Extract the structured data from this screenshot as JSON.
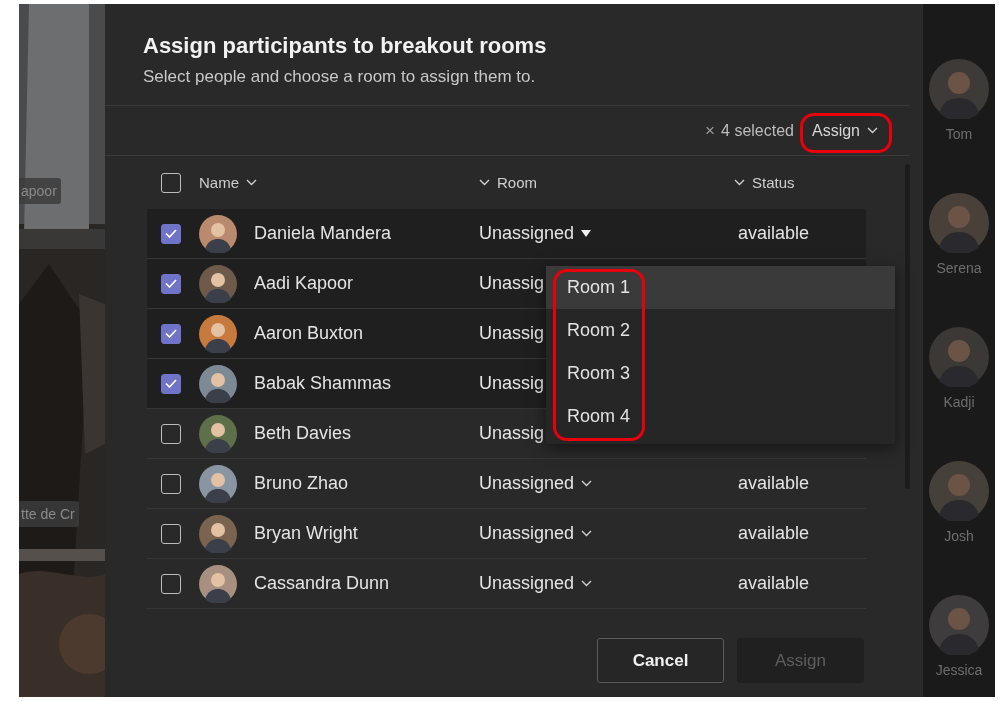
{
  "background_video": {
    "name_tags": [
      "apoor",
      "tte de Cr"
    ]
  },
  "dialog": {
    "title": "Assign participants to breakout rooms",
    "subtitle": "Select people and choose a room to assign them to.",
    "toolbar": {
      "clear": "×",
      "selected_count": "4 selected",
      "assign": "Assign"
    },
    "table": {
      "columns": [
        "Name",
        "Room",
        "Status"
      ],
      "select_all_checked": false,
      "rows": [
        {
          "name": "Daniela Mandera",
          "room": "Unassigned",
          "room_menu_open": true,
          "status": "available",
          "checked": true
        },
        {
          "name": "Aadi Kapoor",
          "room": "Unassig",
          "checked": true
        },
        {
          "name": "Aaron Buxton",
          "room": "Unassig",
          "checked": true
        },
        {
          "name": "Babak Shammas",
          "room": "Unassig",
          "checked": true
        },
        {
          "name": "Beth Davies",
          "room": "Unassig",
          "checked": false
        },
        {
          "name": "Bruno Zhao",
          "room": "Unassigned",
          "room_menu_open": false,
          "status": "available",
          "checked": false
        },
        {
          "name": "Bryan Wright",
          "room": "Unassigned",
          "room_menu_open": false,
          "status": "available",
          "checked": false
        },
        {
          "name": "Cassandra Dunn",
          "room": "Unassigned",
          "room_menu_open": false,
          "status": "available",
          "checked": false
        }
      ]
    },
    "room_menu": [
      {
        "label": "Room 1",
        "selected": true
      },
      {
        "label": "Room 2",
        "selected": false
      },
      {
        "label": "Room 3",
        "selected": false
      },
      {
        "label": "Room 4",
        "selected": false
      }
    ],
    "buttons": [
      {
        "label": "Cancel",
        "disabled": false
      },
      {
        "label": "Assign",
        "disabled": true
      }
    ]
  },
  "participants": [
    "Tom",
    "Serena",
    "Kadji",
    "Josh",
    "Jessica"
  ]
}
